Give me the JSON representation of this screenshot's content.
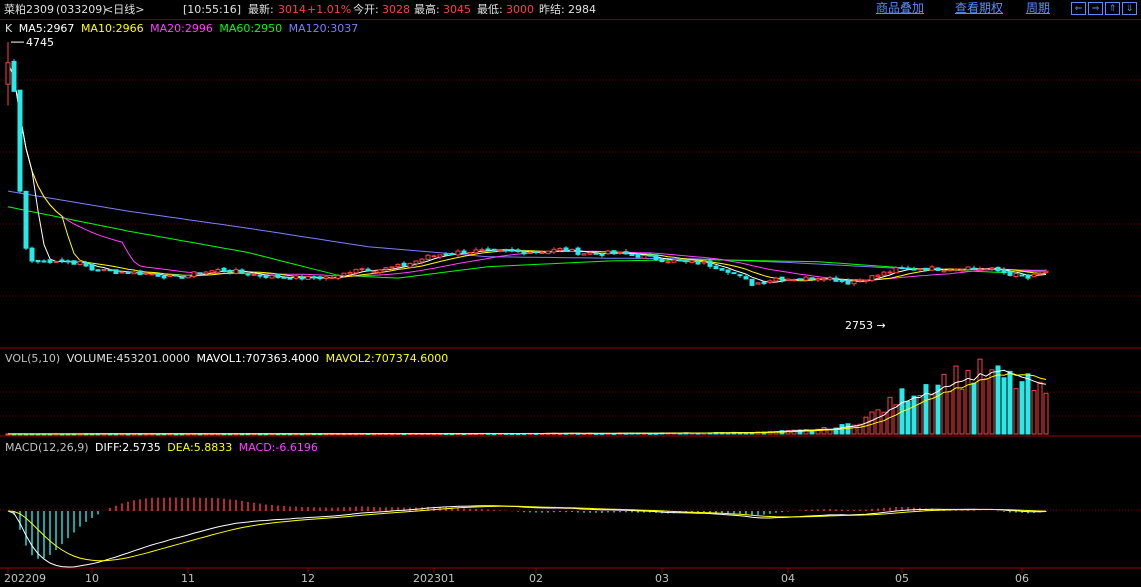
{
  "header": {
    "symbol": "菜粕2309",
    "code": "(033209)",
    "period": "<日线>",
    "time": "[10:55:16]",
    "last_label": "最新:",
    "last_value": "3014",
    "change": "+1.01%",
    "open_label": "今开:",
    "open_value": "3028",
    "high_label": "最高:",
    "high_value": "3045",
    "low_label": "最低:",
    "low_value": "3000",
    "prev_label": "昨结:",
    "prev_value": "2984",
    "link_overlay": "商品叠加",
    "link_options": "查看期权",
    "link_period": "周期",
    "nav_buttons": [
      "⇐",
      "⇒",
      "⇑",
      "⇓"
    ]
  },
  "colors": {
    "up": "#ff4040",
    "down": "#28e8e8",
    "ma5": "#ffffff",
    "ma10": "#ffff00",
    "ma20": "#ff40ff",
    "ma60": "#00ff00",
    "ma120": "#7d7dff",
    "grid": "#7a0000",
    "axis": "#9a0000"
  },
  "price_legend": {
    "k": "K",
    "ma5": "MA5:2967",
    "ma10": "MA10:2966",
    "ma20": "MA20:2996",
    "ma60": "MA60:2950",
    "ma120": "MA120:3037"
  },
  "vol_legend": {
    "title": "VOL(5,10)",
    "volume": "VOLUME:453201.0000",
    "mavol1": "MAVOL1:707363.4000",
    "mavol2": "MAVOL2:707374.6000"
  },
  "macd_legend": {
    "title": "MACD(12,26,9)",
    "diff": "DIFF:2.5735",
    "dea": "DEA:5.8833",
    "macd": "MACD:-6.6196"
  },
  "annotations": {
    "high": "4745",
    "low": "2753"
  },
  "chart_data": {
    "type": "candlestick",
    "x_labels": [
      {
        "label": "202209",
        "index": 0
      },
      {
        "label": "10",
        "index": 14
      },
      {
        "label": "11",
        "index": 30
      },
      {
        "label": "12",
        "index": 50
      },
      {
        "label": "202301",
        "index": 71
      },
      {
        "label": "02",
        "index": 88
      },
      {
        "label": "03",
        "index": 109
      },
      {
        "label": "04",
        "index": 130
      },
      {
        "label": "05",
        "index": 149
      },
      {
        "label": "06",
        "index": 169
      }
    ],
    "close_keypoints": [
      [
        0,
        4600
      ],
      [
        1,
        4400
      ],
      [
        2,
        3700
      ],
      [
        3,
        3300
      ],
      [
        4,
        3210
      ],
      [
        5,
        3205
      ],
      [
        8,
        3215
      ],
      [
        12,
        3195
      ],
      [
        14,
        3150
      ],
      [
        18,
        3135
      ],
      [
        24,
        3120
      ],
      [
        28,
        3090
      ],
      [
        32,
        3130
      ],
      [
        36,
        3150
      ],
      [
        40,
        3120
      ],
      [
        44,
        3100
      ],
      [
        50,
        3090
      ],
      [
        55,
        3100
      ],
      [
        58,
        3160
      ],
      [
        62,
        3150
      ],
      [
        66,
        3180
      ],
      [
        70,
        3240
      ],
      [
        74,
        3270
      ],
      [
        78,
        3280
      ],
      [
        84,
        3275
      ],
      [
        88,
        3275
      ],
      [
        92,
        3290
      ],
      [
        96,
        3265
      ],
      [
        100,
        3265
      ],
      [
        104,
        3255
      ],
      [
        108,
        3225
      ],
      [
        112,
        3205
      ],
      [
        116,
        3195
      ],
      [
        120,
        3145
      ],
      [
        124,
        3050
      ],
      [
        126,
        3065
      ],
      [
        128,
        3090
      ],
      [
        132,
        3085
      ],
      [
        136,
        3100
      ],
      [
        140,
        3060
      ],
      [
        142,
        3080
      ],
      [
        144,
        3100
      ],
      [
        148,
        3150
      ],
      [
        152,
        3160
      ],
      [
        156,
        3155
      ],
      [
        160,
        3165
      ],
      [
        164,
        3150
      ],
      [
        168,
        3110
      ],
      [
        170,
        3090
      ],
      [
        172,
        3120
      ],
      [
        173,
        3140
      ]
    ],
    "ma60_keypoints": [
      [
        0,
        3590
      ],
      [
        20,
        3420
      ],
      [
        40,
        3270
      ],
      [
        55,
        3110
      ],
      [
        65,
        3090
      ],
      [
        80,
        3170
      ],
      [
        100,
        3210
      ],
      [
        115,
        3220
      ],
      [
        135,
        3205
      ],
      [
        150,
        3160
      ],
      [
        165,
        3130
      ],
      [
        173,
        3140
      ]
    ],
    "ma120_keypoints": [
      [
        0,
        3700
      ],
      [
        20,
        3560
      ],
      [
        40,
        3440
      ],
      [
        60,
        3310
      ],
      [
        80,
        3240
      ],
      [
        100,
        3230
      ],
      [
        115,
        3225
      ],
      [
        130,
        3200
      ],
      [
        150,
        3155
      ],
      [
        173,
        3145
      ]
    ],
    "volume_keypoints": [
      [
        0,
        1500
      ],
      [
        20,
        2000
      ],
      [
        40,
        3000
      ],
      [
        60,
        4000
      ],
      [
        80,
        6000
      ],
      [
        100,
        8000
      ],
      [
        115,
        12000
      ],
      [
        125,
        20000
      ],
      [
        132,
        40000
      ],
      [
        138,
        70000
      ],
      [
        142,
        150000
      ],
      [
        146,
        300000
      ],
      [
        150,
        480000
      ],
      [
        154,
        600000
      ],
      [
        158,
        660000
      ],
      [
        162,
        700000
      ],
      [
        166,
        640000
      ],
      [
        170,
        560000
      ],
      [
        173,
        453201
      ]
    ],
    "price_range": [
      2600,
      4900
    ],
    "volume_range": [
      0,
      800000
    ],
    "macd_range": [
      -100,
      100
    ],
    "bar_count": 174
  }
}
